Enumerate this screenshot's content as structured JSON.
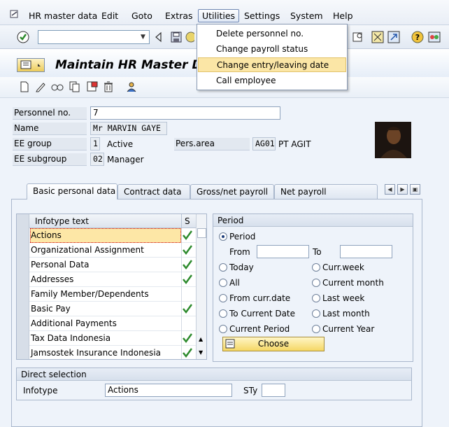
{
  "menubar": {
    "items": [
      {
        "id": "hr",
        "label": "HR master data"
      },
      {
        "id": "edit",
        "label": "Edit"
      },
      {
        "id": "goto",
        "label": "Goto"
      },
      {
        "id": "extras",
        "label": "Extras"
      },
      {
        "id": "utilities",
        "label": "Utilities"
      },
      {
        "id": "settings",
        "label": "Settings"
      },
      {
        "id": "system",
        "label": "System"
      },
      {
        "id": "help",
        "label": "Help"
      }
    ]
  },
  "utilities_menu": {
    "items": [
      "Delete personnel no.",
      "Change payroll status",
      "Change entry/leaving date",
      "Call employee"
    ],
    "highlighted_index": 2
  },
  "toolbar": {
    "command_value": ""
  },
  "page": {
    "title": "Maintain HR Master Dat"
  },
  "header": {
    "personnel_no_label": "Personnel no.",
    "personnel_no_value": "7",
    "name_label": "Name",
    "name_value": "Mr MARVIN GAYE",
    "ee_group_label": "EE group",
    "ee_group_code": "1",
    "ee_group_text": "Active",
    "pers_area_label": "Pers.area",
    "pers_area_code": "AG01",
    "pers_area_text": "PT AGIT",
    "ee_subgroup_label": "EE subgroup",
    "ee_subgroup_code": "02",
    "ee_subgroup_text": "Manager"
  },
  "tabs": [
    {
      "label": "Basic personal data",
      "active": true
    },
    {
      "label": "Contract data",
      "active": false
    },
    {
      "label": "Gross/net payroll",
      "active": false
    },
    {
      "label": "Net payroll",
      "active": false
    }
  ],
  "infotypes": {
    "col_text": "Infotype text",
    "col_s": "S",
    "rows": [
      {
        "text": "Actions",
        "check": true
      },
      {
        "text": "Organizational Assignment",
        "check": true
      },
      {
        "text": "Personal Data",
        "check": true
      },
      {
        "text": "Addresses",
        "check": true
      },
      {
        "text": "Family Member/Dependents",
        "check": false
      },
      {
        "text": "Basic Pay",
        "check": true
      },
      {
        "text": "Additional Payments",
        "check": false
      },
      {
        "text": "Tax Data Indonesia",
        "check": true
      },
      {
        "text": "Jamsostek Insurance Indonesia",
        "check": true
      }
    ]
  },
  "period": {
    "title": "Period",
    "period_label": "Period",
    "from_label": "From",
    "to_label": "To",
    "options_left": [
      "Today",
      "All",
      "From curr.date",
      "To Current Date",
      "Current Period"
    ],
    "options_right": [
      "Curr.week",
      "Current month",
      "Last week",
      "Last month",
      "Current Year"
    ],
    "choose_label": "Choose"
  },
  "direct_selection": {
    "title": "Direct selection",
    "infotype_label": "Infotype",
    "infotype_value": "Actions",
    "sty_label": "STy",
    "sty_value": ""
  },
  "colors": {
    "accent": "#fbe6a6",
    "check": "#2e8b2e",
    "panel": "#eef3fa"
  }
}
